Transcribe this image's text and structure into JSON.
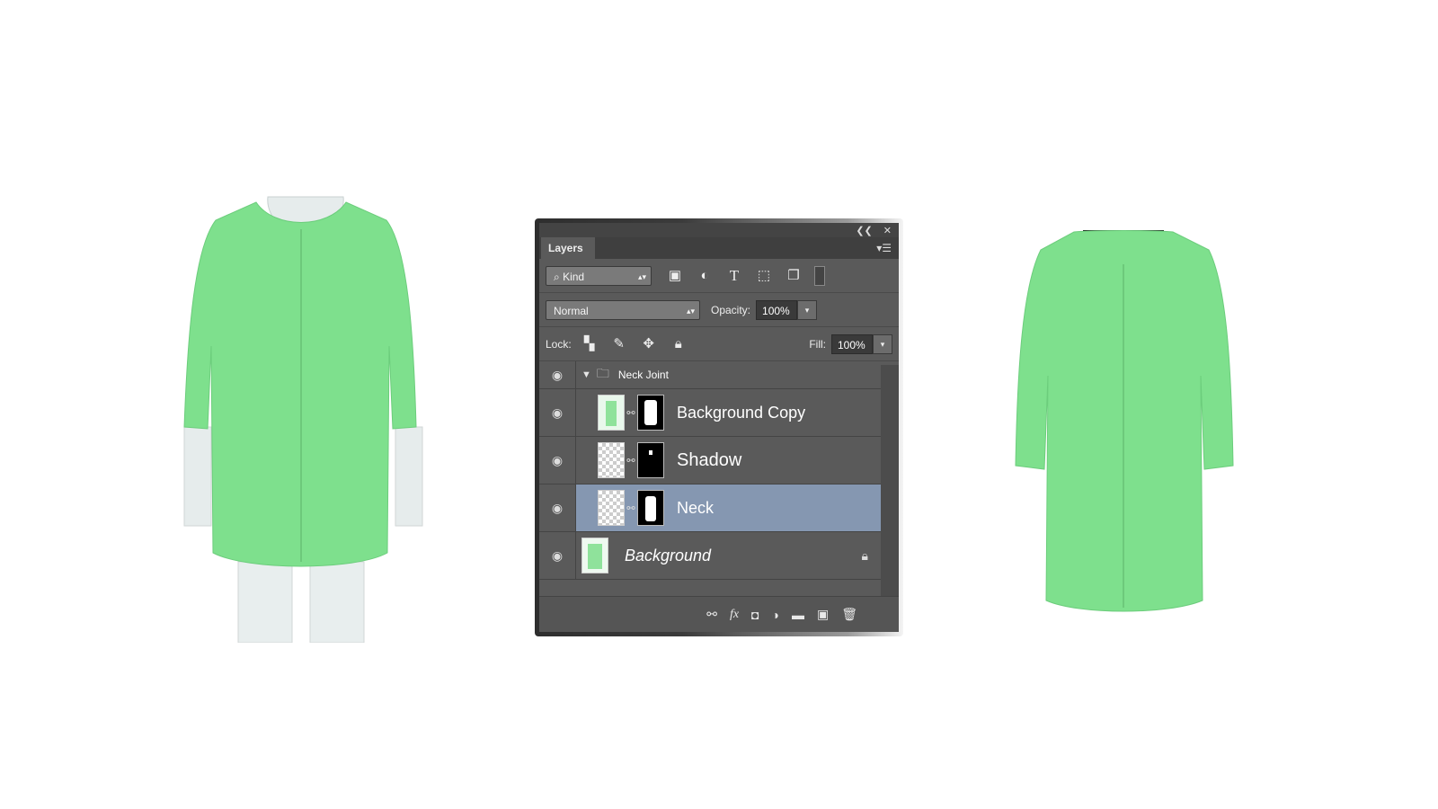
{
  "panel": {
    "tab_label": "Layers",
    "filter_label": "Kind",
    "blend_mode": "Normal",
    "opacity_label": "Opacity:",
    "opacity_value": "100%",
    "lock_label": "Lock:",
    "fill_label": "Fill:",
    "fill_value": "100%"
  },
  "layers": [
    {
      "name": "Neck Joint",
      "type": "group",
      "visible": true,
      "expanded": true
    },
    {
      "name": "Background Copy",
      "type": "masked",
      "visible": true
    },
    {
      "name": "Shadow",
      "type": "masked",
      "visible": true
    },
    {
      "name": "Neck",
      "type": "masked",
      "visible": true,
      "selected": true
    },
    {
      "name": "Background",
      "type": "locked",
      "visible": true
    }
  ],
  "icons": {
    "collapse": "double-chevron-left-icon",
    "close": "close-icon",
    "panel_menu": "panel-menu-icon"
  },
  "colors": {
    "coat": "#7ee08d",
    "selected_layer": "#8597b1",
    "panel_bg": "#5a5a5a"
  }
}
